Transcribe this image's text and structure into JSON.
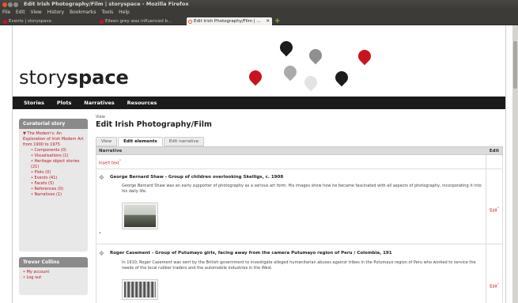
{
  "browser": {
    "window_title": "Edit Irish Photography/Film | storyspace - Mozilla Firefox",
    "menu": [
      "File",
      "Edit",
      "View",
      "History",
      "Bookmarks",
      "Tools",
      "Help"
    ],
    "tabs": [
      {
        "label": "Events | storyspace",
        "active": false
      },
      {
        "label": "Eileen grey was influenced b...",
        "active": false
      },
      {
        "label": "Edit Irish Photography/Film | ...",
        "active": true
      }
    ],
    "new_tab": "+",
    "tab_close": "✕"
  },
  "site": {
    "logo_plain": "story",
    "logo_bold": "space",
    "nav": [
      "Stories",
      "Plots",
      "Narratives",
      "Resources"
    ]
  },
  "sidebar": {
    "curatorial": {
      "heading": "Curatorial story",
      "story": "▼ The Modern's: An Exploration of Irish Modern Art from 1900 to 1975",
      "items": [
        "Components (0)",
        "Visualisations (1)",
        "Heritage object stories (21)",
        "Plots (0)",
        "Events (41)",
        "Facets (5)",
        "References (0)",
        "Narratives (1)"
      ]
    },
    "user": {
      "heading": "Trevor Collins",
      "items": [
        "My account",
        "Log out"
      ]
    }
  },
  "main": {
    "crumb": "View",
    "title": "Edit Irish Photography/Film",
    "tabs": [
      "View",
      "Edit elements",
      "Edit narrative"
    ],
    "active_tab": "Edit elements",
    "columns": [
      "Narrative",
      "Edit"
    ],
    "insert_text": "Insert text",
    "items": [
      {
        "title": "George Bernard Shaw - Group of children overlooking Skelligs, c. 1908",
        "text": "George Bernard Shaw was an early supporter of photography as a serious art form. His images show how he became fascinated with all aspects of photography, incorporating it into his daily life.",
        "edit": "Edit"
      },
      {
        "title": "Roger Casement - Group of Putumayo girls, facing away from the camera Putumayo region of Peru / Colombia, 191",
        "text": "In 1910, Roger Casement was sent by the British government to investigate alleged humanitarian abuses against tribes in the Putumayo region of Peru who worked to service the needs of the local rubber traders and the automobile industries in the West.",
        "edit": "Edit"
      }
    ],
    "handle_glyph": "✥",
    "bullet_glyph": "•",
    "ext_glyph": "°"
  }
}
